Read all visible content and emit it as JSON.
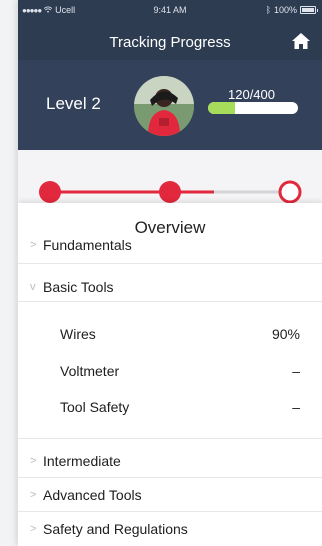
{
  "status_bar": {
    "carrier": "Ucell",
    "time": "9:41 AM",
    "battery": "100%"
  },
  "nav": {
    "title": "Tracking Progress",
    "home_icon": "home-icon"
  },
  "profile": {
    "level": "Level 2",
    "xp_text": "120/400",
    "xp_fraction": 0.3,
    "avatar_icon": "avatar"
  },
  "progress_track": {
    "steps_completed": 2,
    "steps_total": 3,
    "accent_color": "#e2283c"
  },
  "overview": {
    "title": "Overview",
    "sections": [
      {
        "label": "Fundamentals",
        "expanded": false
      },
      {
        "label": "Basic Tools",
        "expanded": true,
        "items": [
          {
            "name": "Wires",
            "value": "90%"
          },
          {
            "name": "Voltmeter",
            "value": "–"
          },
          {
            "name": "Tool Safety",
            "value": "–"
          }
        ]
      },
      {
        "label": "Intermediate",
        "expanded": false
      },
      {
        "label": "Advanced Tools",
        "expanded": false
      },
      {
        "label": "Safety and Regulations",
        "expanded": false
      }
    ]
  },
  "colors": {
    "header": "#2e3c52",
    "profile_bg": "#34415a",
    "xp_fill": "#a6dc5a",
    "accent": "#e2283c"
  }
}
